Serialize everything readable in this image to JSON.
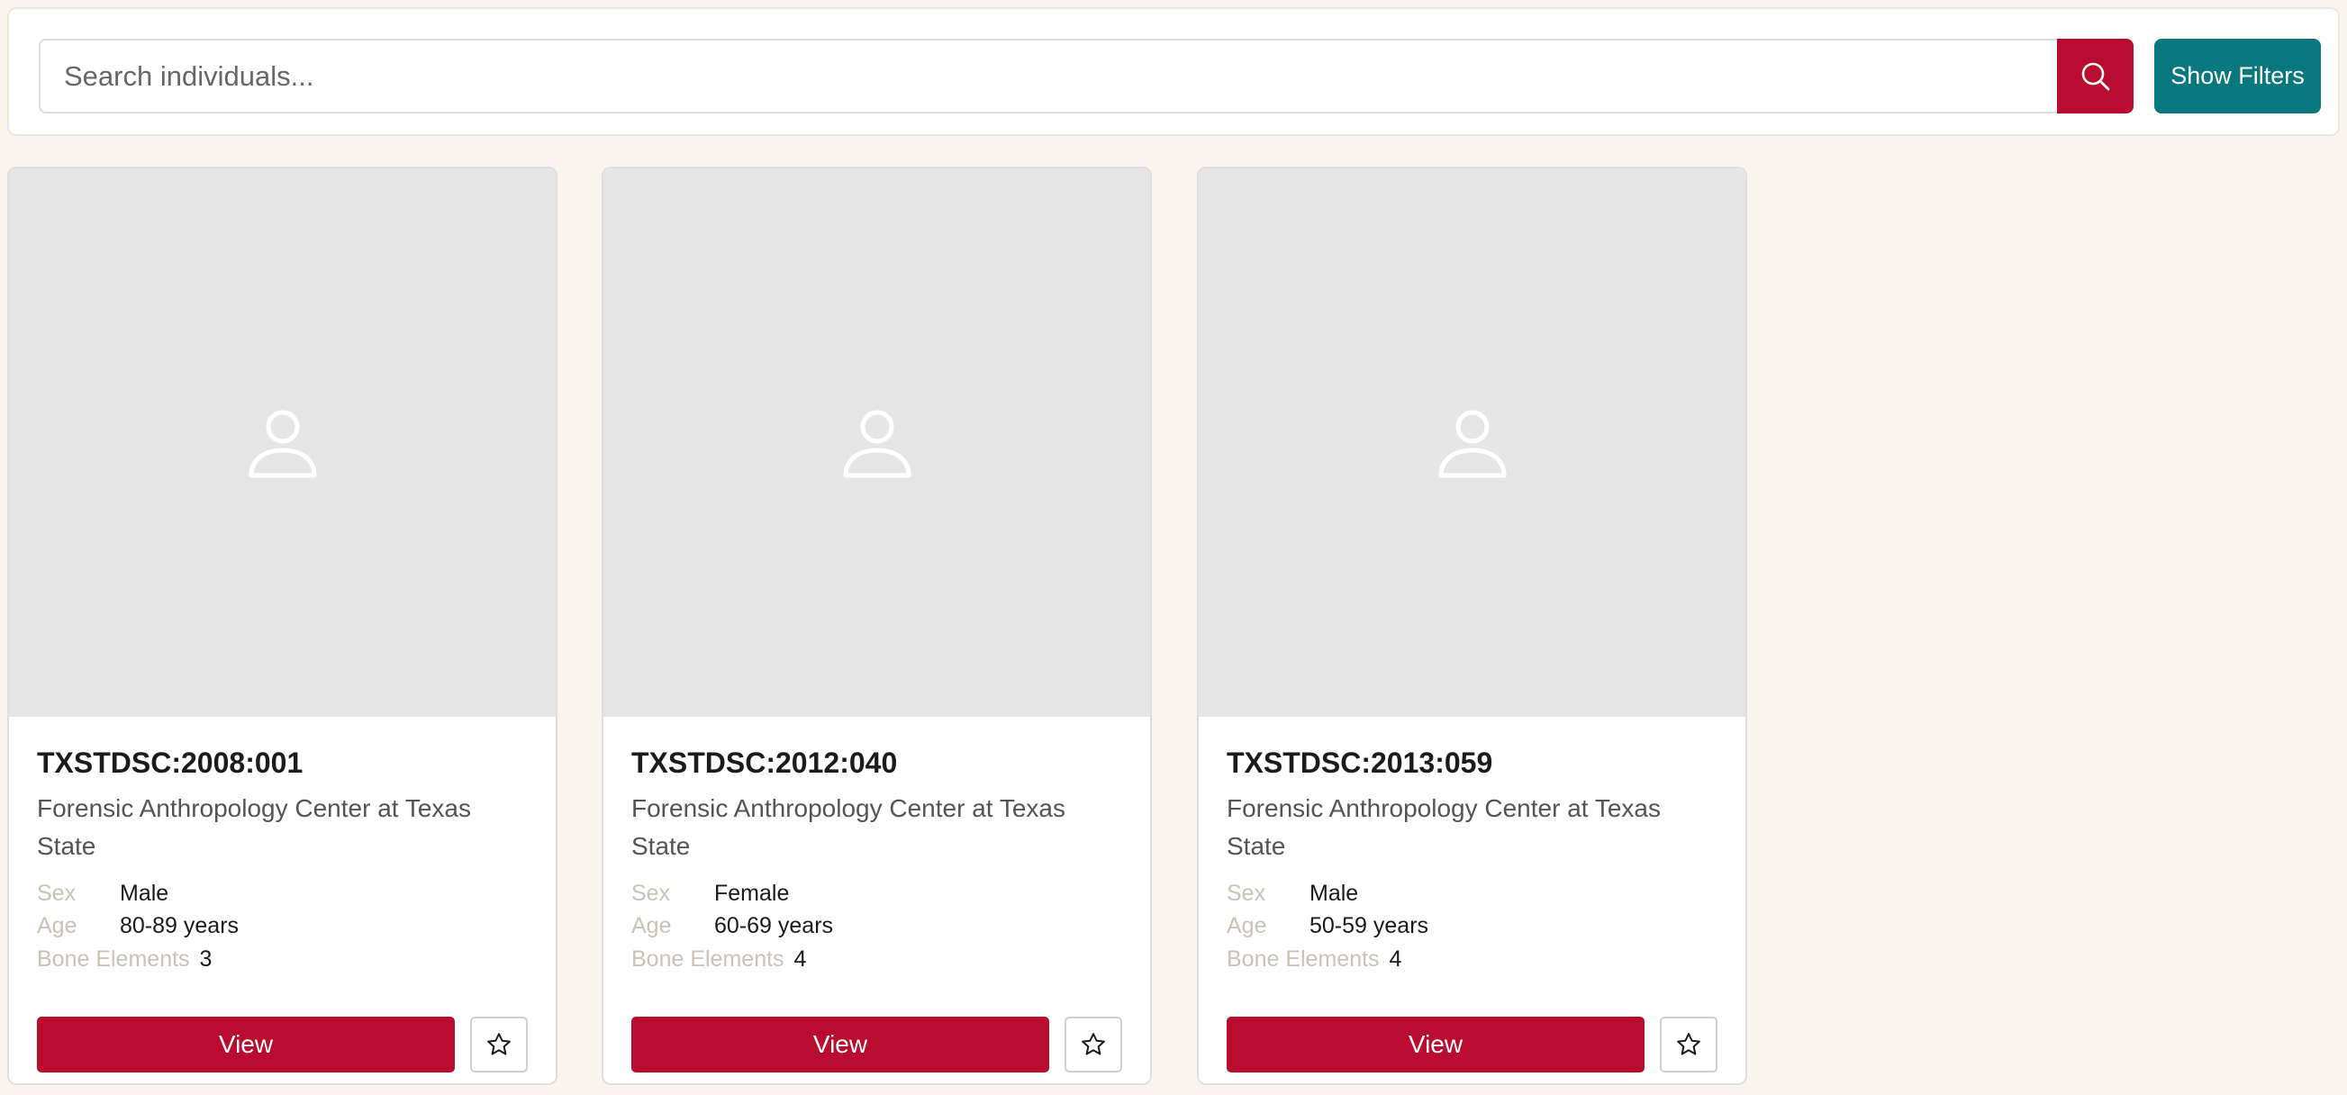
{
  "search": {
    "placeholder": "Search individuals...",
    "search_icon": "search-icon",
    "filters_label": "Show Filters"
  },
  "colors": {
    "page_background": "#f9f5ee",
    "primary": "#b90c2f",
    "accent_teal": "#08777e",
    "image_placeholder": "#e5e5e5"
  },
  "labels": {
    "sex": "Sex",
    "age": "Age",
    "bone_elements": "Bone Elements",
    "view": "View"
  },
  "cards": [
    {
      "id": "TXSTDSC:2008:001",
      "institution": "Forensic Anthropology Center at Texas State",
      "sex": "Male",
      "age": "80-89 years",
      "bone_elements": "3",
      "image_icon": "user-placeholder-icon",
      "favorite_icon": "star-icon"
    },
    {
      "id": "TXSTDSC:2012:040",
      "institution": "Forensic Anthropology Center at Texas State",
      "sex": "Female",
      "age": "60-69 years",
      "bone_elements": "4",
      "image_icon": "user-placeholder-icon",
      "favorite_icon": "star-icon"
    },
    {
      "id": "TXSTDSC:2013:059",
      "institution": "Forensic Anthropology Center at Texas State",
      "sex": "Male",
      "age": "50-59 years",
      "bone_elements": "4",
      "image_icon": "user-placeholder-icon",
      "favorite_icon": "star-icon"
    }
  ]
}
